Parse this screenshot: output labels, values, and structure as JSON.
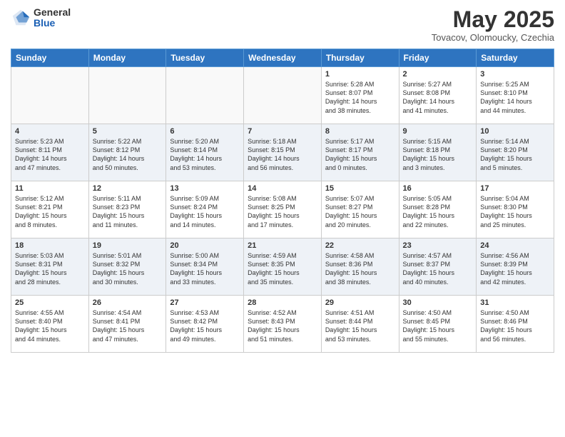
{
  "header": {
    "logo": {
      "line1": "General",
      "line2": "Blue"
    },
    "title": "May 2025",
    "subtitle": "Tovacov, Olomoucky, Czechia"
  },
  "weekdays": [
    "Sunday",
    "Monday",
    "Tuesday",
    "Wednesday",
    "Thursday",
    "Friday",
    "Saturday"
  ],
  "weeks": [
    [
      {
        "day": "",
        "info": ""
      },
      {
        "day": "",
        "info": ""
      },
      {
        "day": "",
        "info": ""
      },
      {
        "day": "",
        "info": ""
      },
      {
        "day": "1",
        "info": "Sunrise: 5:28 AM\nSunset: 8:07 PM\nDaylight: 14 hours\nand 38 minutes."
      },
      {
        "day": "2",
        "info": "Sunrise: 5:27 AM\nSunset: 8:08 PM\nDaylight: 14 hours\nand 41 minutes."
      },
      {
        "day": "3",
        "info": "Sunrise: 5:25 AM\nSunset: 8:10 PM\nDaylight: 14 hours\nand 44 minutes."
      }
    ],
    [
      {
        "day": "4",
        "info": "Sunrise: 5:23 AM\nSunset: 8:11 PM\nDaylight: 14 hours\nand 47 minutes."
      },
      {
        "day": "5",
        "info": "Sunrise: 5:22 AM\nSunset: 8:12 PM\nDaylight: 14 hours\nand 50 minutes."
      },
      {
        "day": "6",
        "info": "Sunrise: 5:20 AM\nSunset: 8:14 PM\nDaylight: 14 hours\nand 53 minutes."
      },
      {
        "day": "7",
        "info": "Sunrise: 5:18 AM\nSunset: 8:15 PM\nDaylight: 14 hours\nand 56 minutes."
      },
      {
        "day": "8",
        "info": "Sunrise: 5:17 AM\nSunset: 8:17 PM\nDaylight: 15 hours\nand 0 minutes."
      },
      {
        "day": "9",
        "info": "Sunrise: 5:15 AM\nSunset: 8:18 PM\nDaylight: 15 hours\nand 3 minutes."
      },
      {
        "day": "10",
        "info": "Sunrise: 5:14 AM\nSunset: 8:20 PM\nDaylight: 15 hours\nand 5 minutes."
      }
    ],
    [
      {
        "day": "11",
        "info": "Sunrise: 5:12 AM\nSunset: 8:21 PM\nDaylight: 15 hours\nand 8 minutes."
      },
      {
        "day": "12",
        "info": "Sunrise: 5:11 AM\nSunset: 8:23 PM\nDaylight: 15 hours\nand 11 minutes."
      },
      {
        "day": "13",
        "info": "Sunrise: 5:09 AM\nSunset: 8:24 PM\nDaylight: 15 hours\nand 14 minutes."
      },
      {
        "day": "14",
        "info": "Sunrise: 5:08 AM\nSunset: 8:25 PM\nDaylight: 15 hours\nand 17 minutes."
      },
      {
        "day": "15",
        "info": "Sunrise: 5:07 AM\nSunset: 8:27 PM\nDaylight: 15 hours\nand 20 minutes."
      },
      {
        "day": "16",
        "info": "Sunrise: 5:05 AM\nSunset: 8:28 PM\nDaylight: 15 hours\nand 22 minutes."
      },
      {
        "day": "17",
        "info": "Sunrise: 5:04 AM\nSunset: 8:30 PM\nDaylight: 15 hours\nand 25 minutes."
      }
    ],
    [
      {
        "day": "18",
        "info": "Sunrise: 5:03 AM\nSunset: 8:31 PM\nDaylight: 15 hours\nand 28 minutes."
      },
      {
        "day": "19",
        "info": "Sunrise: 5:01 AM\nSunset: 8:32 PM\nDaylight: 15 hours\nand 30 minutes."
      },
      {
        "day": "20",
        "info": "Sunrise: 5:00 AM\nSunset: 8:34 PM\nDaylight: 15 hours\nand 33 minutes."
      },
      {
        "day": "21",
        "info": "Sunrise: 4:59 AM\nSunset: 8:35 PM\nDaylight: 15 hours\nand 35 minutes."
      },
      {
        "day": "22",
        "info": "Sunrise: 4:58 AM\nSunset: 8:36 PM\nDaylight: 15 hours\nand 38 minutes."
      },
      {
        "day": "23",
        "info": "Sunrise: 4:57 AM\nSunset: 8:37 PM\nDaylight: 15 hours\nand 40 minutes."
      },
      {
        "day": "24",
        "info": "Sunrise: 4:56 AM\nSunset: 8:39 PM\nDaylight: 15 hours\nand 42 minutes."
      }
    ],
    [
      {
        "day": "25",
        "info": "Sunrise: 4:55 AM\nSunset: 8:40 PM\nDaylight: 15 hours\nand 44 minutes."
      },
      {
        "day": "26",
        "info": "Sunrise: 4:54 AM\nSunset: 8:41 PM\nDaylight: 15 hours\nand 47 minutes."
      },
      {
        "day": "27",
        "info": "Sunrise: 4:53 AM\nSunset: 8:42 PM\nDaylight: 15 hours\nand 49 minutes."
      },
      {
        "day": "28",
        "info": "Sunrise: 4:52 AM\nSunset: 8:43 PM\nDaylight: 15 hours\nand 51 minutes."
      },
      {
        "day": "29",
        "info": "Sunrise: 4:51 AM\nSunset: 8:44 PM\nDaylight: 15 hours\nand 53 minutes."
      },
      {
        "day": "30",
        "info": "Sunrise: 4:50 AM\nSunset: 8:45 PM\nDaylight: 15 hours\nand 55 minutes."
      },
      {
        "day": "31",
        "info": "Sunrise: 4:50 AM\nSunset: 8:46 PM\nDaylight: 15 hours\nand 56 minutes."
      }
    ]
  ]
}
